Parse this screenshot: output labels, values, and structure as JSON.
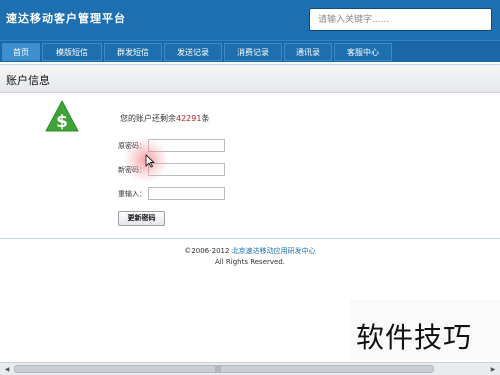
{
  "app": {
    "title": "速达移动客户管理平台",
    "search_placeholder": "请输入关键字......"
  },
  "nav": {
    "tabs": [
      {
        "label": "首页",
        "active": true
      },
      {
        "label": "模版短信",
        "active": false
      },
      {
        "label": "群发短信",
        "active": false
      },
      {
        "label": "发送记录",
        "active": false
      },
      {
        "label": "消费记录",
        "active": false
      },
      {
        "label": "通讯录",
        "active": false
      },
      {
        "label": "客服中心",
        "active": false
      }
    ]
  },
  "account": {
    "page_title": "账户信息",
    "balance_prefix": "您的账户还剩余",
    "balance_count": "42291",
    "balance_suffix": "条",
    "fields": [
      {
        "label": "原密码：",
        "value": ""
      },
      {
        "label": "新密码：",
        "value": ""
      },
      {
        "label": "重输入：",
        "value": ""
      }
    ],
    "submit_label": "更新密码"
  },
  "footer": {
    "copyright_prefix": "©2006-2012 ",
    "org_name": "北京速达移动应用研发中心",
    "rights": "All Rights Reserved."
  },
  "scrollbar": {
    "left_arrow": "◀",
    "right_arrow": "▶",
    "grip": "|||"
  },
  "watermark": {
    "text": "软件技巧"
  },
  "colors": {
    "header_bg": "#1e6fb0",
    "nav_active": "#3d8fd0",
    "balance_red": "#b22222",
    "icon_green": "#3fa33a"
  },
  "icons": {
    "money": "dollar-triangle-icon",
    "cursor": "mouse-pointer-icon"
  }
}
